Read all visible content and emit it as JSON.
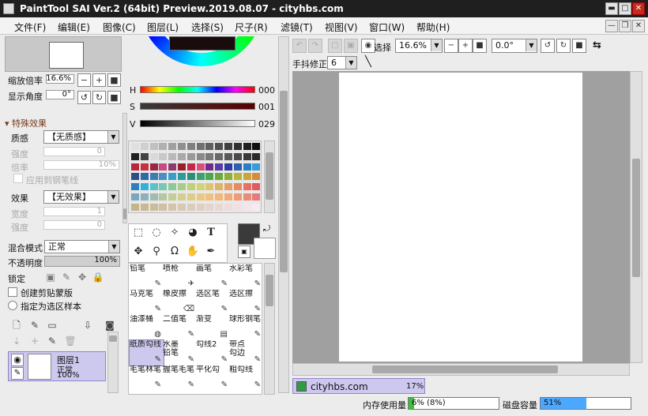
{
  "window": {
    "title": "PaintTool SAI Ver.2 (64bit) Preview.2019.08.07 - cityhbs.com",
    "min": "▬",
    "max": "□",
    "close": "✕"
  },
  "menu": [
    "文件(F)",
    "编辑(E)",
    "图像(C)",
    "图层(L)",
    "选择(S)",
    "尺子(R)",
    "滤镜(T)",
    "视图(V)",
    "窗口(W)",
    "帮助(H)"
  ],
  "mdi": {
    "min": "—",
    "restore": "❐",
    "close": "✕"
  },
  "navigator": {
    "zoom_label": "缩放倍率",
    "zoom_value": "16.6%",
    "rotate_label": "显示角度",
    "rotate_value": "0°",
    "minus": "−",
    "plus": "+",
    "stop": "■",
    "rot_left": "↺",
    "rot_right": "↻"
  },
  "effects": {
    "section": "特殊效果",
    "texture_label": "质感",
    "texture_value": "【无质感】",
    "strength_label": "强度",
    "strength_value": "0",
    "scale_label": "倍率",
    "scale_value": "10%",
    "apply_pen": "应用到钢笔线",
    "effect_label": "效果",
    "effect_value": "【无效果】",
    "width_label": "宽度",
    "width_value": "1",
    "strength2_label": "强度",
    "strength2_value": "0"
  },
  "layer": {
    "blend_label": "混合模式",
    "blend_value": "正常",
    "opacity_label": "不透明度",
    "opacity_value": "100%",
    "lock_label": "锁定",
    "clip_label": "创建剪贴蒙版",
    "select_src_label": "指定为选区样本",
    "name": "图层1",
    "mode": "正常",
    "opacity": "100%"
  },
  "hsv": {
    "h_label": "H",
    "h_value": "000",
    "s_label": "S",
    "s_value": "001",
    "v_label": "V",
    "v_value": "029"
  },
  "tools": {
    "text_tool": "T"
  },
  "brushes": [
    {
      "name": "铅笔",
      "name2": ""
    },
    {
      "name": "喷枪",
      "name2": ""
    },
    {
      "name": "画笔",
      "name2": ""
    },
    {
      "name": "水彩笔",
      "name2": ""
    },
    {
      "name": "马克笔",
      "name2": ""
    },
    {
      "name": "橡皮擦",
      "name2": ""
    },
    {
      "name": "选区笔",
      "name2": ""
    },
    {
      "name": "选区擦",
      "name2": ""
    },
    {
      "name": "油漆桶",
      "name2": ""
    },
    {
      "name": "二值笔",
      "name2": ""
    },
    {
      "name": "渐变",
      "name2": ""
    },
    {
      "name": "球形钢笔",
      "name2": ""
    },
    {
      "name": "纸质勾线",
      "name2": ""
    },
    {
      "name": "水墨",
      "name2": "铅笔"
    },
    {
      "name": "勾线2",
      "name2": ""
    },
    {
      "name": "带点",
      "name2": "勾边"
    },
    {
      "name": "毛笔林笔",
      "name2": ""
    },
    {
      "name": "握笔毛笔",
      "name2": ""
    },
    {
      "name": "平化勾",
      "name2": ""
    },
    {
      "name": "粗勾线",
      "name2": ""
    }
  ],
  "view_toolbar": {
    "select_label": "选择",
    "zoom_value": "16.6%",
    "angle_value": "0.0°",
    "stabilizer_label": "手抖修正",
    "stabilizer_value": "6",
    "flip": "⇆"
  },
  "doc_tab": {
    "name": "cityhbs.com",
    "zoom": "17%"
  },
  "status": {
    "mem_label": "内存使用量",
    "mem_value": "6% (8%)",
    "mem_pct": 6,
    "disk_label": "磁盘容量",
    "disk_value": "51%",
    "disk_pct": 51
  },
  "colors": {
    "accent": "#3a86ff",
    "mem_fill": "#3bbf3b",
    "disk_fill": "#4aa8ff",
    "selected_layer": "#cdc8ee",
    "title_bg": "#1f1f1f"
  }
}
